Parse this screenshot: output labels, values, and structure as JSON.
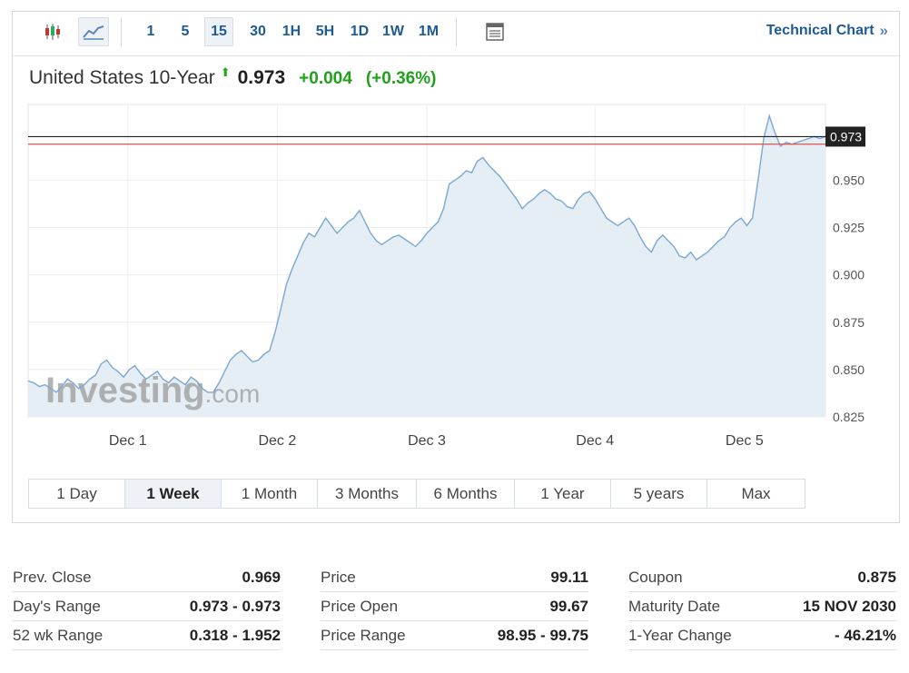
{
  "toolbar": {
    "intervals": [
      "1",
      "5",
      "15",
      "30",
      "1H",
      "5H",
      "1D",
      "1W",
      "1M"
    ],
    "active_interval": "15",
    "technical_chart_label": "Technical Chart",
    "technical_chart_chevron": "»",
    "icons": [
      "candlestick-icon",
      "area-chart-icon",
      "table-view-icon"
    ]
  },
  "quote": {
    "name": "United States 10-Year",
    "direction_arrow": "⬆",
    "price": "0.973",
    "change": "+0.004",
    "change_pct": "(+0.36%)",
    "up_color": "#21a11b"
  },
  "watermark": {
    "brand": "Investing",
    "suffix": ".com"
  },
  "price_label": "0.973",
  "chart_data": {
    "type": "area",
    "title": "",
    "xlabel": "",
    "ylabel": "",
    "x_ticks": [
      "Dec 1",
      "Dec 2",
      "Dec 3",
      "Dec 4",
      "Dec 5"
    ],
    "y_ticks": [
      "0.825",
      "0.850",
      "0.875",
      "0.900",
      "0.925",
      "0.950"
    ],
    "ylim": [
      0.825,
      0.99
    ],
    "x_domain": [
      0,
      128
    ],
    "x_tick_positions": [
      16,
      40,
      64,
      91,
      115
    ],
    "grid": true,
    "line_color": "#7aa7d4",
    "fill_color": "#e6eef5",
    "current_price_line": 0.973,
    "previous_close_line": 0.969,
    "current_line_color": "#222222",
    "prev_close_line_color": "#d9534f",
    "series": [
      {
        "values": [
          0.844,
          0.843,
          0.841,
          0.842,
          0.84,
          0.838,
          0.841,
          0.845,
          0.843,
          0.84,
          0.842,
          0.845,
          0.847,
          0.853,
          0.855,
          0.851,
          0.849,
          0.846,
          0.85,
          0.852,
          0.848,
          0.845,
          0.847,
          0.849,
          0.845,
          0.843,
          0.846,
          0.844,
          0.842,
          0.846,
          0.844,
          0.84,
          0.838,
          0.838,
          0.843,
          0.849,
          0.855,
          0.858,
          0.86,
          0.857,
          0.854,
          0.855,
          0.858,
          0.86,
          0.87,
          0.882,
          0.895,
          0.903,
          0.91,
          0.917,
          0.922,
          0.92,
          0.925,
          0.93,
          0.926,
          0.922,
          0.925,
          0.928,
          0.93,
          0.934,
          0.928,
          0.922,
          0.918,
          0.916,
          0.918,
          0.92,
          0.921,
          0.919,
          0.917,
          0.915,
          0.918,
          0.922,
          0.925,
          0.928,
          0.935,
          0.948,
          0.95,
          0.952,
          0.955,
          0.954,
          0.96,
          0.962,
          0.958,
          0.955,
          0.952,
          0.948,
          0.944,
          0.94,
          0.935,
          0.938,
          0.94,
          0.943,
          0.945,
          0.943,
          0.94,
          0.939,
          0.936,
          0.935,
          0.94,
          0.943,
          0.944,
          0.94,
          0.935,
          0.93,
          0.928,
          0.926,
          0.928,
          0.93,
          0.926,
          0.92,
          0.915,
          0.912,
          0.918,
          0.921,
          0.918,
          0.915,
          0.91,
          0.909,
          0.912,
          0.908,
          0.91,
          0.912,
          0.915,
          0.918,
          0.92,
          0.925,
          0.928,
          0.93,
          0.926,
          0.93,
          0.95,
          0.972,
          0.984,
          0.975,
          0.968,
          0.97,
          0.969,
          0.97,
          0.971,
          0.972,
          0.973,
          0.972,
          0.973
        ]
      }
    ]
  },
  "ranges": {
    "items": [
      "1 Day",
      "1 Week",
      "1 Month",
      "3 Months",
      "6 Months",
      "1 Year",
      "5 years",
      "Max"
    ],
    "active": "1 Week"
  },
  "stats": {
    "col1": [
      {
        "label": "Prev. Close",
        "value": "0.969"
      },
      {
        "label": "Day's Range",
        "value": "0.973 - 0.973"
      },
      {
        "label": "52 wk Range",
        "value": "0.318 - 1.952"
      }
    ],
    "col2": [
      {
        "label": "Price",
        "value": "99.11"
      },
      {
        "label": "Price Open",
        "value": "99.67"
      },
      {
        "label": "Price Range",
        "value": "98.95 - 99.75"
      }
    ],
    "col3": [
      {
        "label": "Coupon",
        "value": "0.875"
      },
      {
        "label": "Maturity Date",
        "value": "15 NOV 2030"
      },
      {
        "label": "1-Year Change",
        "value": "- 46.21%"
      }
    ]
  }
}
